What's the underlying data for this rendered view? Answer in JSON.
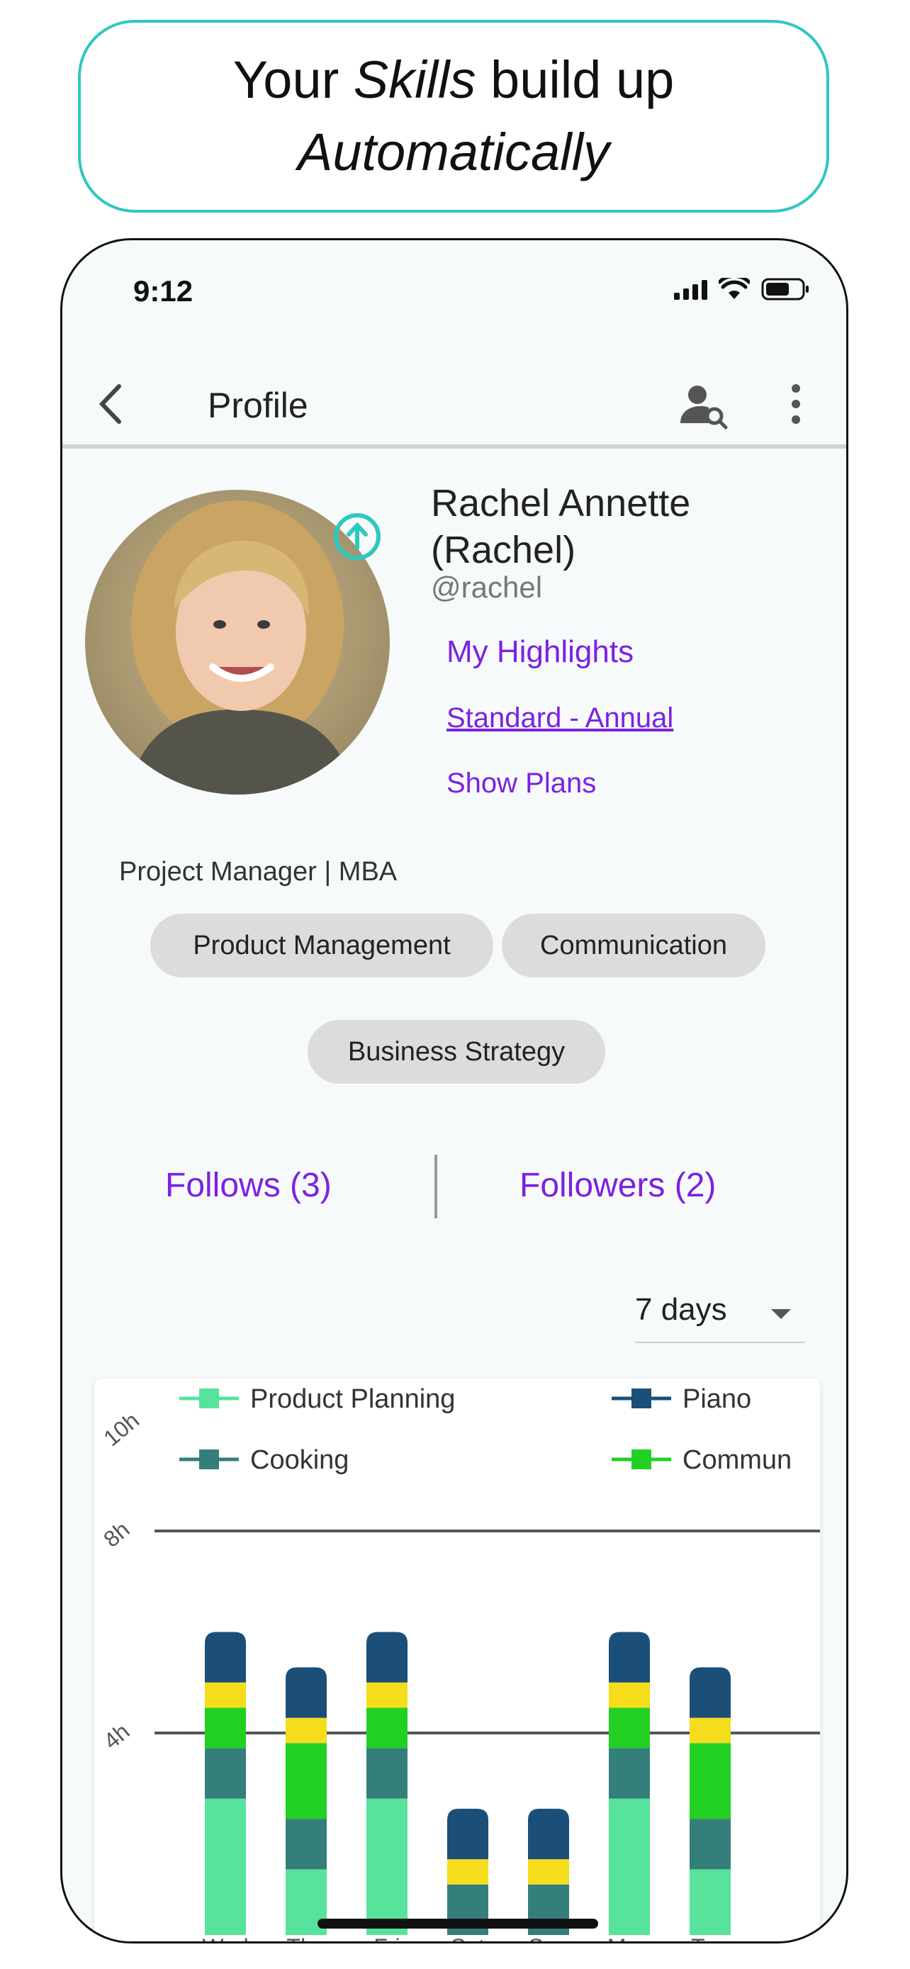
{
  "banner": {
    "line1_pre": "Your ",
    "line1_italic": "Skills",
    "line1_post": " build up",
    "line2_italic": "Automatically"
  },
  "status_bar": {
    "time": "9:12"
  },
  "app_bar": {
    "title": "Profile"
  },
  "profile": {
    "name_line1": "Rachel Annette",
    "name_line2": "(Rachel)",
    "handle": "@rachel",
    "highlights_link": "My Highlights",
    "plan_link": "Standard - Annual",
    "show_plans_link": "Show Plans",
    "headline": "Project Manager | MBA",
    "skills": [
      "Product Management",
      "Communication",
      "Business Strategy"
    ]
  },
  "social": {
    "follows": "Follows (3)",
    "followers": "Followers (2)"
  },
  "range_select": {
    "selected": "7 days"
  },
  "chart_data": {
    "type": "bar",
    "stacked": true,
    "y_ticks": [
      "10h",
      "8h",
      "4h"
    ],
    "y_tick_values": [
      10,
      8,
      4
    ],
    "legend": [
      "Product Planning",
      "Piano",
      "Cooking",
      "Commun"
    ],
    "categories": [
      "Wed",
      "Thu",
      "Fri",
      "Sat",
      "Sun",
      "Mon",
      "Tue"
    ],
    "series": [
      {
        "name": "Product Planning",
        "color": "#57e39b",
        "values": [
          2.7,
          1.3,
          2.7,
          0,
          0,
          2.7,
          1.3
        ]
      },
      {
        "name": "Cooking",
        "color": "#357f7b",
        "values": [
          1.0,
          1.0,
          1.0,
          1.0,
          1.0,
          1.0,
          1.0
        ]
      },
      {
        "name": "Commun",
        "color": "#22d022",
        "values": [
          0.8,
          1.5,
          0.8,
          0,
          0,
          0.8,
          1.5
        ]
      },
      {
        "name": "Yellow",
        "color": "#f5dd1b",
        "values": [
          0.5,
          0.5,
          0.5,
          0.5,
          0.5,
          0.5,
          0.5
        ]
      },
      {
        "name": "Piano",
        "color": "#1b4f78",
        "values": [
          1.0,
          1.0,
          1.0,
          1.0,
          1.0,
          1.0,
          1.0
        ]
      }
    ],
    "gridlines": [
      8,
      4
    ]
  }
}
